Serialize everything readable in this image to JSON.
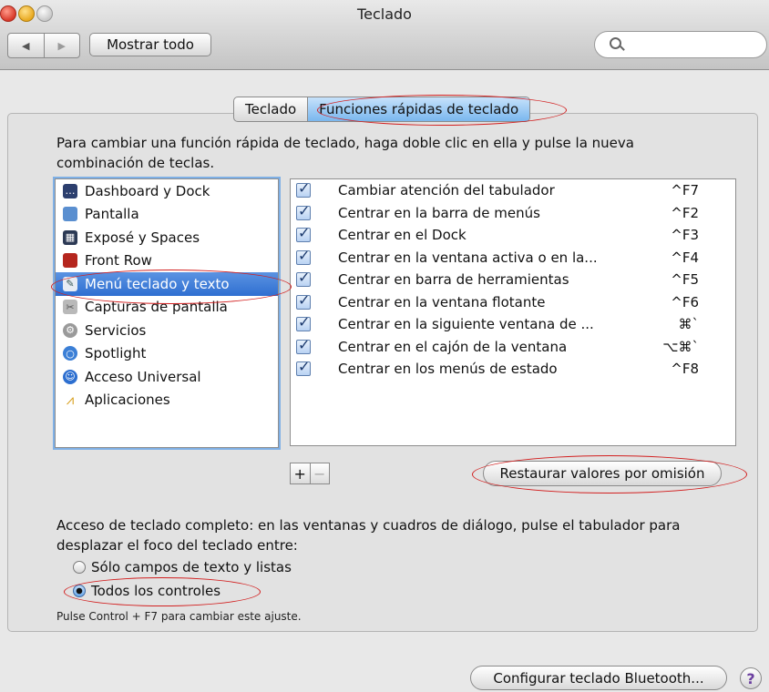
{
  "window": {
    "title": "Teclado"
  },
  "toolbar": {
    "show_all": "Mostrar todo"
  },
  "tabs": [
    {
      "label": "Teclado",
      "selected": false
    },
    {
      "label": "Funciones rápidas de teclado",
      "selected": true
    }
  ],
  "instructions": "Para cambiar una función rápida de teclado, haga doble clic en ella y pulse la nueva combinación de teclas.",
  "categories": [
    {
      "label": "Dashboard y Dock",
      "icon": "dashboard-icon"
    },
    {
      "label": "Pantalla",
      "icon": "display-icon"
    },
    {
      "label": "Exposé y Spaces",
      "icon": "expose-icon"
    },
    {
      "label": "Front Row",
      "icon": "front-row-icon"
    },
    {
      "label": "Menú teclado y texto",
      "icon": "keyboard-menu-icon",
      "selected": true
    },
    {
      "label": "Capturas de pantalla",
      "icon": "screenshot-icon"
    },
    {
      "label": "Servicios",
      "icon": "gear-icon"
    },
    {
      "label": "Spotlight",
      "icon": "spotlight-icon"
    },
    {
      "label": "Acceso Universal",
      "icon": "accessibility-icon"
    },
    {
      "label": "Aplicaciones",
      "icon": "applications-icon"
    }
  ],
  "shortcuts": [
    {
      "label": "Cambiar atención del tabulador",
      "key": "^F7"
    },
    {
      "label": "Centrar en la barra de menús",
      "key": "^F2"
    },
    {
      "label": "Centrar en el Dock",
      "key": "^F3"
    },
    {
      "label": "Centrar en la ventana activa o en la...",
      "key": "^F4"
    },
    {
      "label": "Centrar en barra de herramientas",
      "key": "^F5"
    },
    {
      "label": "Centrar en la ventana flotante",
      "key": "^F6"
    },
    {
      "label": "Centrar en la siguiente ventana de ...",
      "key": "⌘`"
    },
    {
      "label": "Centrar en el cajón de la ventana",
      "key": "⌥⌘`"
    },
    {
      "label": "Centrar en los menús de estado",
      "key": "^F8"
    }
  ],
  "buttons": {
    "add": "+",
    "remove": "−",
    "restore": "Restaurar valores por omisión",
    "bluetooth": "Configurar teclado Bluetooth...",
    "help": "?"
  },
  "access": {
    "text": "Acceso de teclado completo: en las ventanas y cuadros de diálogo, pulse el tabulador para desplazar el foco del teclado entre:",
    "options": [
      {
        "label": "Sólo campos de texto y listas",
        "selected": false
      },
      {
        "label": "Todos los controles",
        "selected": true
      }
    ],
    "note": "Pulse Control + F7 para cambiar este ajuste."
  },
  "colors": {
    "selection": "#3a78d6",
    "annotation": "#d21f1f"
  }
}
